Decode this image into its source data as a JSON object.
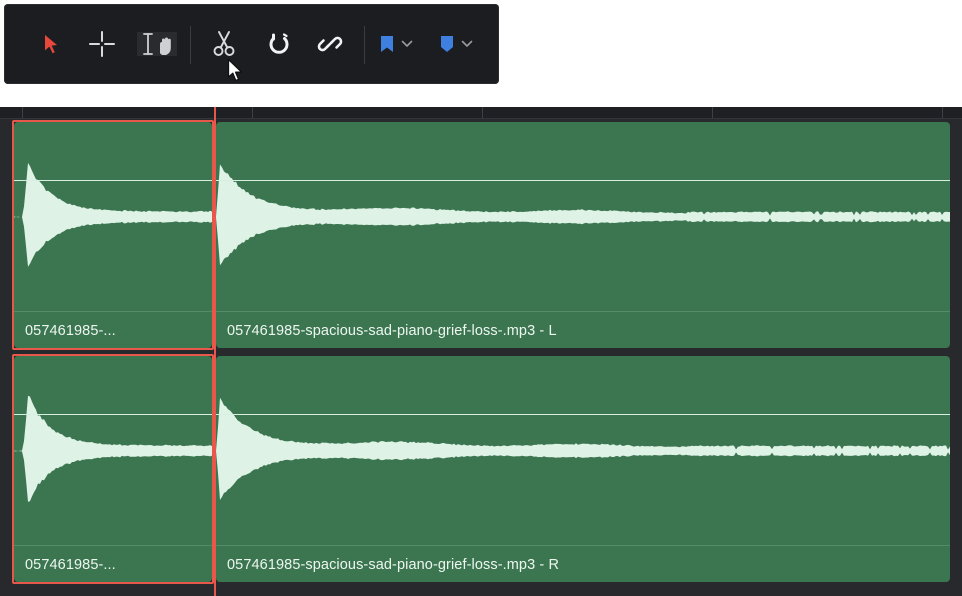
{
  "toolbar": {
    "tools": [
      {
        "name": "selection-mode",
        "icon": "arrow-pointer-icon",
        "active": true,
        "color": "#e8483c"
      },
      {
        "name": "trim-edit-mode",
        "icon": "crosshair-icon"
      },
      {
        "name": "range-selection-hand",
        "icon": "text-cursor-hand-icon"
      },
      {
        "name": "blade-edit-mode",
        "icon": "scissors-icon"
      },
      {
        "name": "snapping",
        "icon": "magnet-icon"
      },
      {
        "name": "linked-selection",
        "icon": "link-icon"
      },
      {
        "name": "flag",
        "icon": "flag-icon",
        "color": "#3f7fe0"
      },
      {
        "name": "marker",
        "icon": "marker-icon",
        "color": "#3f7fe0"
      }
    ]
  },
  "timeline": {
    "tracks": [
      {
        "channel": "L",
        "clips": [
          {
            "label": "057461985-...",
            "selected": true
          },
          {
            "label": "057461985-spacious-sad-piano-grief-loss-.mp3 - L",
            "selected": false
          }
        ]
      },
      {
        "channel": "R",
        "clips": [
          {
            "label": "057461985-...",
            "selected": true
          },
          {
            "label": "057461985-spacious-sad-piano-grief-loss-.mp3 - R",
            "selected": false
          }
        ]
      }
    ],
    "colors": {
      "clip": "#3b7651",
      "waveform": "#dff2e6",
      "selection": "#e8574a",
      "playhead": "#e8574a"
    }
  }
}
